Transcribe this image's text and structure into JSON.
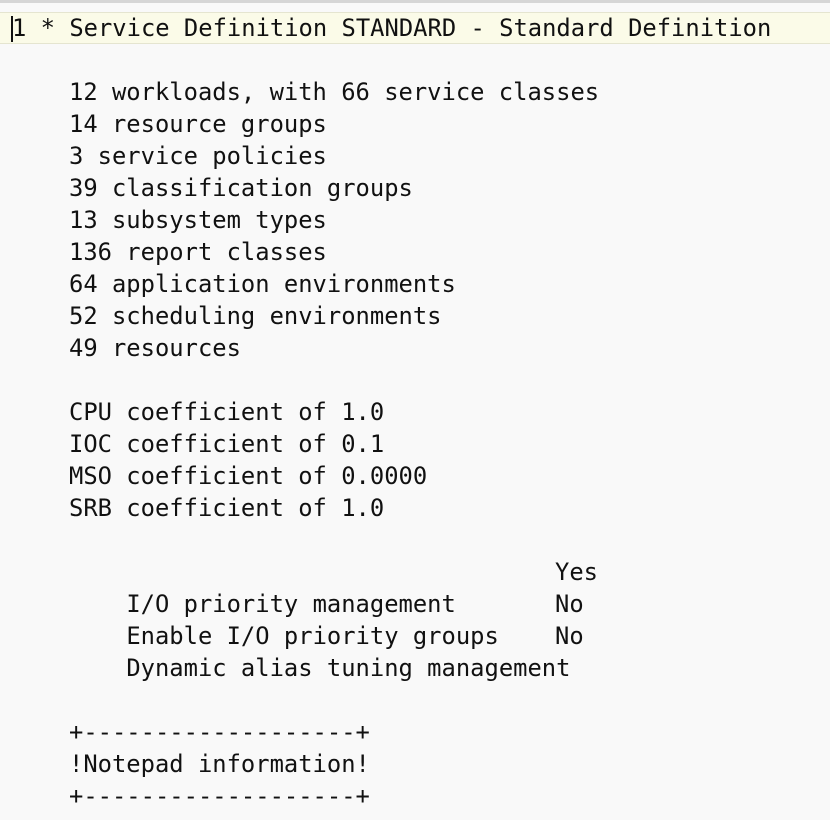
{
  "header_line": {
    "line_number": "1",
    "marker": "*",
    "text": "Service Definition STANDARD - Standard Definition"
  },
  "counts": [
    "12 workloads, with 66 service classes",
    "14 resource groups",
    "3 service policies",
    "39 classification groups",
    "13 subsystem types",
    "136 report classes",
    "64 application environments",
    "52 scheduling environments",
    "49 resources"
  ],
  "coefficients": [
    "CPU coefficient of 1.0",
    "IOC coefficient of 0.1",
    "MSO coefficient of 0.0000",
    "SRB coefficient of 1.0"
  ],
  "settings": [
    {
      "label": "I/O priority management",
      "value": "Yes"
    },
    {
      "label": "Enable I/O priority groups",
      "value": "No"
    },
    {
      "label": "Dynamic alias tuning management",
      "value": "No"
    }
  ],
  "notepad": {
    "border": "+-------------------+",
    "title": "!Notepad information!"
  }
}
